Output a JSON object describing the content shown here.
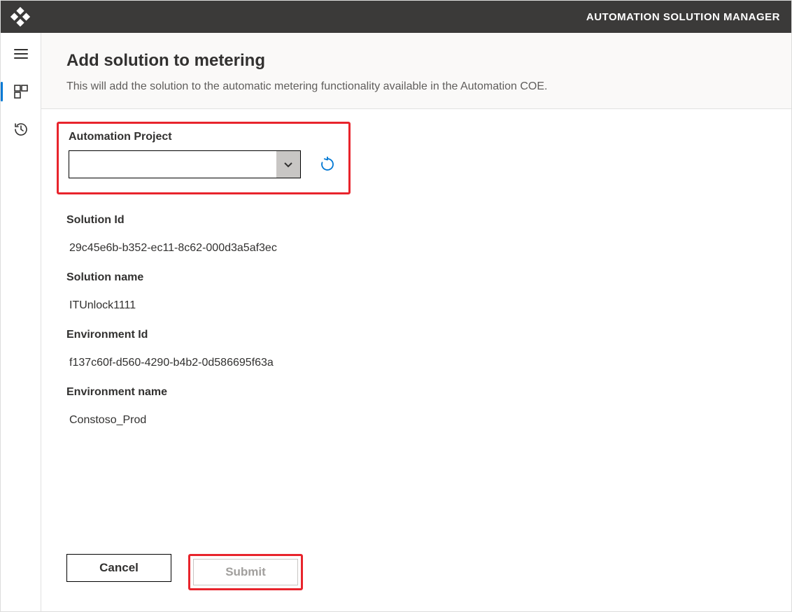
{
  "topbar": {
    "title": "AUTOMATION SOLUTION MANAGER"
  },
  "page": {
    "heading": "Add solution to metering",
    "description": "This will add the solution to the automatic metering functionality available in the Automation COE."
  },
  "form": {
    "automation_project_label": "Automation Project",
    "automation_project_value": "",
    "solution_id_label": "Solution Id",
    "solution_id_value": "29c45e6b-b352-ec11-8c62-000d3a5af3ec",
    "solution_name_label": "Solution name",
    "solution_name_value": "ITUnlock1111",
    "environment_id_label": "Environment Id",
    "environment_id_value": "f137c60f-d560-4290-b4b2-0d586695f63a",
    "environment_name_label": "Environment name",
    "environment_name_value": "Constoso_Prod"
  },
  "actions": {
    "cancel_label": "Cancel",
    "submit_label": "Submit"
  }
}
